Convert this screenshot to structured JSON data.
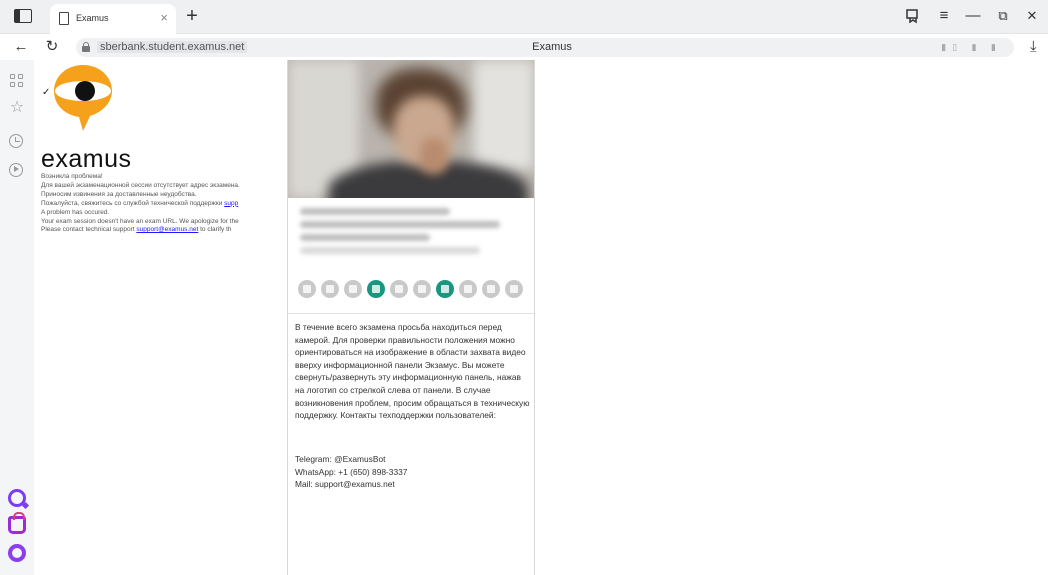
{
  "browser": {
    "tab": {
      "title": "Examus",
      "close_label": "×"
    },
    "new_tab_label": "+",
    "url": "sberbank.student.examus.net",
    "page_title": "Examus",
    "window_controls": {
      "minimize": "—",
      "restore": "⧉",
      "close": "✕"
    },
    "menu_label": "≡"
  },
  "page": {
    "logo_word": "examus",
    "logo_colors": {
      "orange": "#f5a11c",
      "dark": "#111111"
    },
    "error_lines_ru": [
      "Возникла проблема!",
      "Для вашей экзаменационной сессии отсутствует адрес экзамена.",
      "Приносим извинения за доставленные неудобства.",
      "Пожалуйста, свяжитесь со службой технической поддержки"
    ],
    "support_link_partial": "supp",
    "error_lines_en": [
      "A problem has occured.",
      "Your exam session doesn't have an exam URL. We apologize for the"
    ],
    "contact_prefix": "Please contact technical support ",
    "support_email_link": "support@examus.net",
    "contact_suffix": " to clarify th"
  },
  "panel": {
    "accent_color": "#1a9680",
    "status_icons": [
      {
        "name": "microphone-status-icon",
        "active": false
      },
      {
        "name": "pause-status-icon",
        "active": false
      },
      {
        "name": "screen-status-icon",
        "active": false
      },
      {
        "name": "check-status-icon",
        "active": true
      },
      {
        "name": "camera-status-icon",
        "active": false
      },
      {
        "name": "phone-status-icon",
        "active": false
      },
      {
        "name": "calendar-status-icon",
        "active": true
      },
      {
        "name": "exit-status-icon",
        "active": false
      },
      {
        "name": "eye-status-icon",
        "active": false
      },
      {
        "name": "person-status-icon",
        "active": false
      }
    ],
    "instructions": "В течение всего экзамена просьба находиться перед камерой. Для проверки правильности положения можно ориентироваться на изображение в области захвата видео вверху информационной панели Экзамус. Вы можете свернуть/развернуть эту информационную панель, нажав на логотип со стрелкой слева от панели. В случае возникновения проблем, просим обращаться в техническую поддержку. Контакты техподдержки пользователей:",
    "contacts": {
      "telegram": "Telegram: @ExamusBot",
      "whatsapp": "WhatsApp: +1 (650) 898-3337",
      "mail": "Mail: support@examus.net"
    }
  }
}
